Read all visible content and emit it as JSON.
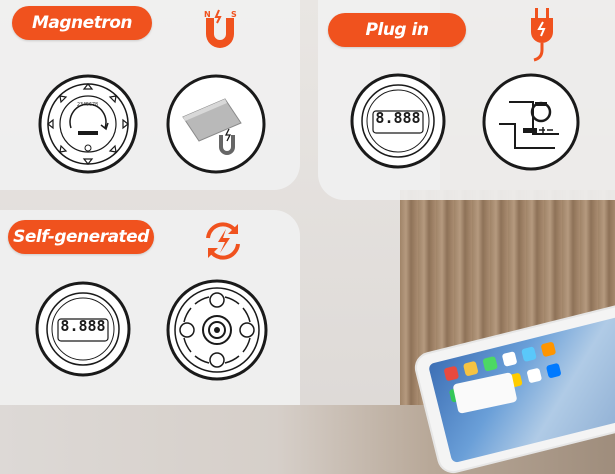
{
  "sections": {
    "magnetron": {
      "label": "Magnetron",
      "icon": "magnet-icon",
      "icon_text_n": "N",
      "icon_text_s": "S"
    },
    "plugin": {
      "label": "Plug in",
      "icon": "plug-icon",
      "display": "8.888"
    },
    "self_generated": {
      "label": "Self-generated",
      "icon": "recycle-energy-icon",
      "display": "8.888"
    }
  },
  "colors": {
    "accent": "#f0521e",
    "panel": "#f0f0f0",
    "line": "#1a1a1a"
  }
}
